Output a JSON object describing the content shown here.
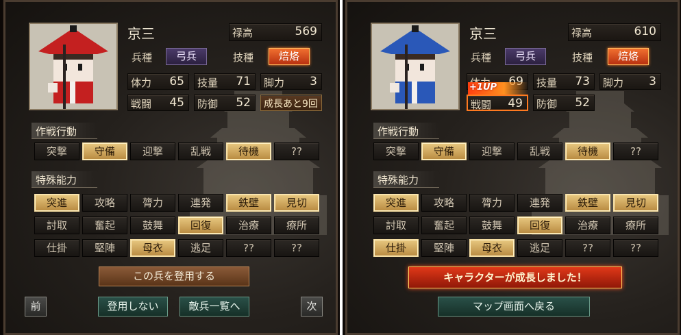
{
  "panels": [
    {
      "name": "京三",
      "stipend_label": "禄高",
      "stipend_value": "569",
      "troop_label": "兵種",
      "troop_value": "弓兵",
      "skill_label": "技種",
      "skill_value": "焙烙",
      "stats": {
        "hp_label": "体力",
        "hp": "65",
        "tech_label": "技量",
        "tech": "71",
        "leg_label": "脚力",
        "leg": "3",
        "atk_label": "戦闘",
        "atk": "45",
        "def_label": "防御",
        "def": "52"
      },
      "growth_text": "成長あと9回",
      "hat_color": "#c42020",
      "clothes_color": "#c42020",
      "tactics_title": "作戦行動",
      "tactics": [
        {
          "label": "突撃",
          "on": false
        },
        {
          "label": "守備",
          "on": true
        },
        {
          "label": "迎撃",
          "on": false
        },
        {
          "label": "乱戦",
          "on": false
        },
        {
          "label": "待機",
          "on": true
        },
        {
          "label": "??",
          "on": false
        }
      ],
      "abilities_title": "特殊能力",
      "abilities": [
        {
          "label": "突進",
          "on": true
        },
        {
          "label": "攻略",
          "on": false
        },
        {
          "label": "膂力",
          "on": false
        },
        {
          "label": "連発",
          "on": false
        },
        {
          "label": "鉄壁",
          "on": true
        },
        {
          "label": "見切",
          "on": true
        },
        {
          "label": "討取",
          "on": false
        },
        {
          "label": "奮起",
          "on": false
        },
        {
          "label": "鼓舞",
          "on": false
        },
        {
          "label": "回復",
          "on": true
        },
        {
          "label": "治療",
          "on": false
        },
        {
          "label": "療所",
          "on": false
        },
        {
          "label": "仕掛",
          "on": false
        },
        {
          "label": "堅陣",
          "on": false
        },
        {
          "label": "母衣",
          "on": true
        },
        {
          "label": "逃足",
          "on": false
        },
        {
          "label": "??",
          "on": false
        },
        {
          "label": "??",
          "on": false
        }
      ],
      "recruit_button": "この兵を登用する",
      "prev_button": "前",
      "decline_button": "登用しない",
      "enemy_list_button": "敵兵一覧へ",
      "next_button": "次"
    },
    {
      "name": "京三",
      "stipend_label": "禄高",
      "stipend_value": "610",
      "troop_label": "兵種",
      "troop_value": "弓兵",
      "skill_label": "技種",
      "skill_value": "焙烙",
      "stats": {
        "hp_label": "体力",
        "hp": "69",
        "tech_label": "技量",
        "tech": "73",
        "leg_label": "脚力",
        "leg": "3",
        "atk_label": "戦闘",
        "atk": "49",
        "def_label": "防御",
        "def": "52"
      },
      "level_up_text": "+1UP",
      "hat_color": "#2a58b8",
      "clothes_color": "#2a58b8",
      "tactics_title": "作戦行動",
      "tactics": [
        {
          "label": "突撃",
          "on": false
        },
        {
          "label": "守備",
          "on": true
        },
        {
          "label": "迎撃",
          "on": false
        },
        {
          "label": "乱戦",
          "on": false
        },
        {
          "label": "待機",
          "on": true
        },
        {
          "label": "??",
          "on": false
        }
      ],
      "abilities_title": "特殊能力",
      "abilities": [
        {
          "label": "突進",
          "on": true
        },
        {
          "label": "攻略",
          "on": false
        },
        {
          "label": "膂力",
          "on": false
        },
        {
          "label": "連発",
          "on": false
        },
        {
          "label": "鉄壁",
          "on": true
        },
        {
          "label": "見切",
          "on": true
        },
        {
          "label": "討取",
          "on": false
        },
        {
          "label": "奮起",
          "on": false
        },
        {
          "label": "鼓舞",
          "on": false
        },
        {
          "label": "回復",
          "on": true
        },
        {
          "label": "治療",
          "on": false
        },
        {
          "label": "療所",
          "on": false
        },
        {
          "label": "仕掛",
          "on": true
        },
        {
          "label": "堅陣",
          "on": false
        },
        {
          "label": "母衣",
          "on": true
        },
        {
          "label": "逃足",
          "on": false
        },
        {
          "label": "??",
          "on": false
        },
        {
          "label": "??",
          "on": false
        }
      ],
      "grown_banner": "キャラクターが成長しました！",
      "map_button": "マップ画面へ戻る"
    }
  ]
}
